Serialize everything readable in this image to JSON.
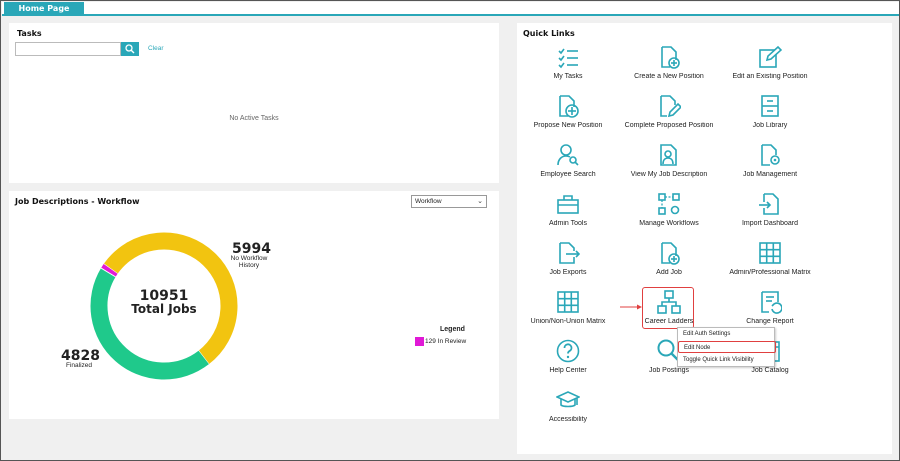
{
  "tabs": [
    {
      "label": "Home Page"
    }
  ],
  "tasks": {
    "title": "Tasks",
    "search_placeholder": "",
    "clear_label": "Clear",
    "empty_text": "No Active Tasks"
  },
  "job_descriptions": {
    "title": "Job Descriptions - Workflow",
    "select_value": "Workflow",
    "total_value": "10951",
    "total_label": "Total Jobs",
    "no_workflow_value": "5994",
    "no_workflow_label_line1": "No Workflow",
    "no_workflow_label_line2": "History",
    "finalized_value": "4828",
    "finalized_label": "Finalized",
    "legend_title": "Legend",
    "legend_entry": "129 In Review",
    "colors": {
      "no_workflow": "#f2c410",
      "finalized": "#1fc98b",
      "in_review": "#e019d6"
    }
  },
  "chart_data": {
    "type": "pie",
    "categories": [
      "No Workflow History",
      "Finalized",
      "In Review"
    ],
    "values": [
      5994,
      4828,
      129
    ],
    "title": "Job Descriptions - Workflow"
  },
  "quick_links": {
    "title": "Quick Links",
    "items": [
      {
        "label": "My Tasks",
        "icon": "checklist-icon"
      },
      {
        "label": "Create a New Position",
        "icon": "doc-plus-icon"
      },
      {
        "label": "Edit an Existing Position",
        "icon": "edit-square-icon"
      },
      {
        "label": "Propose New Position",
        "icon": "doc-plus-circle-icon"
      },
      {
        "label": "Complete Proposed Position",
        "icon": "doc-pencil-icon"
      },
      {
        "label": "Job Library",
        "icon": "cabinet-icon"
      },
      {
        "label": "Employee Search",
        "icon": "person-search-icon"
      },
      {
        "label": "View My Job Description",
        "icon": "person-doc-icon"
      },
      {
        "label": "Job Management",
        "icon": "doc-gear-icon"
      },
      {
        "label": "Admin Tools",
        "icon": "toolbox-icon"
      },
      {
        "label": "Manage Workflows",
        "icon": "workflow-gear-icon"
      },
      {
        "label": "Import Dashboard",
        "icon": "import-icon"
      },
      {
        "label": "Job Exports",
        "icon": "export-icon"
      },
      {
        "label": "Add Job",
        "icon": "doc-plus-icon"
      },
      {
        "label": "Admin/Professional Matrix",
        "icon": "grid-icon"
      },
      {
        "label": "Union/Non-Union Matrix",
        "icon": "grid-icon"
      },
      {
        "label": "Career Ladders",
        "icon": "hierarchy-icon"
      },
      {
        "label": "Change Report",
        "icon": "report-undo-icon"
      },
      {
        "label": "Help Center",
        "icon": "question-icon"
      },
      {
        "label": "Job Postings",
        "icon": "magnifier-icon"
      },
      {
        "label": "Job Catalog",
        "icon": "catalog-icon"
      },
      {
        "label": "Accessibility",
        "icon": "graduation-cap-icon"
      }
    ],
    "context_menu": [
      {
        "label": "Edit Auth Settings"
      },
      {
        "label": "Edit Node"
      },
      {
        "label": "Toggle Quick Link Visibility"
      }
    ],
    "accent_color": "#2aa7b8"
  }
}
